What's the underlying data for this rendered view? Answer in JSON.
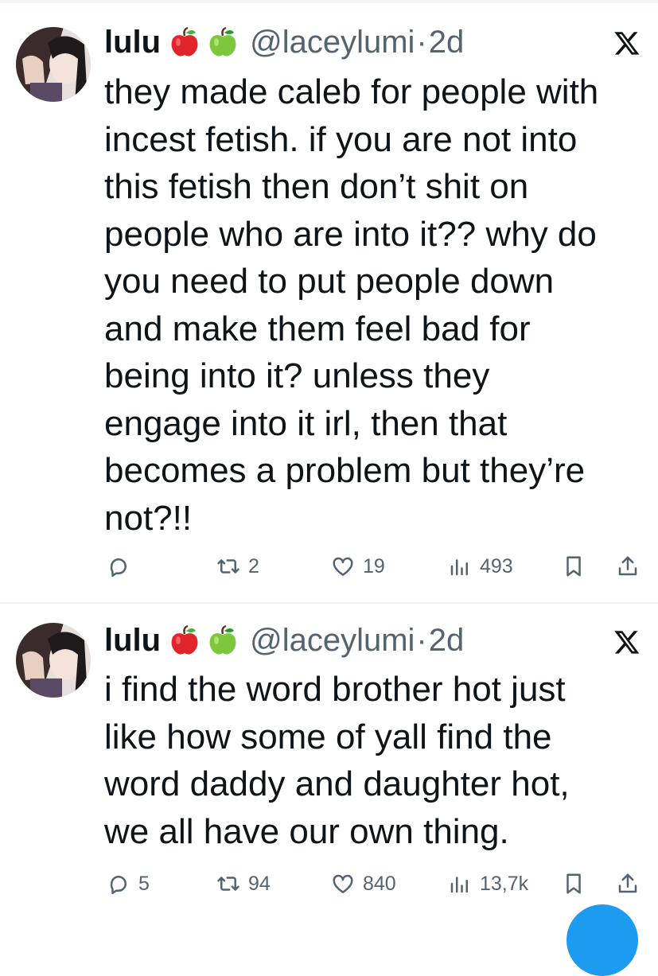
{
  "tweets": [
    {
      "display_name": "lulu",
      "emojis": [
        "red-apple",
        "green-apple"
      ],
      "handle": "@laceylumi",
      "separator": "·",
      "time": "2d",
      "text": "they made caleb for people with\nincest fetish. if you are not into\nthis fetish then don’t shit on\npeople who are into it?? why do\nyou need to put people down\nand make them feel bad for\nbeing into it? unless they\nengage into it irl, then that\nbecomes a problem but they’re\nnot?!!",
      "replies": "",
      "reposts": "2",
      "likes": "19",
      "views": "493"
    },
    {
      "display_name": "lulu",
      "emojis": [
        "red-apple",
        "green-apple"
      ],
      "handle": "@laceylumi",
      "separator": "·",
      "time": "2d",
      "text": "i find the word brother hot just\nlike how some of yall find the\nword daddy and daughter hot,\nwe all have our own thing.",
      "replies": "5",
      "reposts": "94",
      "likes": "840",
      "views": "13,7k"
    }
  ],
  "colors": {
    "text_primary": "#0f1419",
    "text_secondary": "#536471",
    "divider": "#eff3f4",
    "accent_blue": "#1d9bf0"
  },
  "icons": [
    "x-logo-icon",
    "reply-icon",
    "repost-icon",
    "like-icon",
    "views-icon",
    "bookmark-icon",
    "share-icon"
  ]
}
